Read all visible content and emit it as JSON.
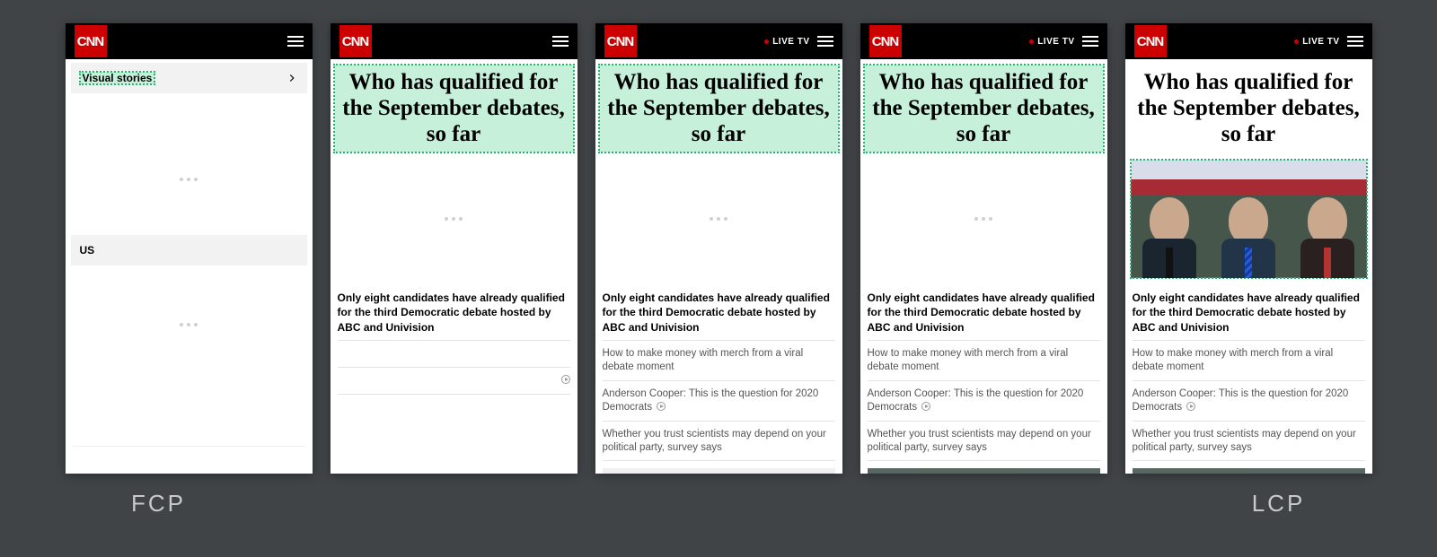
{
  "brand": "CNN",
  "live_tv": "LIVE TV",
  "sections": {
    "visual_stories": "Visual stories",
    "us": "US"
  },
  "headline": "Who has qualified for the September debates, so far",
  "summary": "Only eight candidates have already qualified for the third Democratic debate hosted by ABC and Univision",
  "links": {
    "l1": "How to make money with merch from a viral debate moment",
    "l2": "Anderson Cooper: This is the question for 2020 Democrats",
    "l3": "Whether you trust scientists may depend on your political party, survey says"
  },
  "labels": {
    "fcp": "FCP",
    "lcp": "LCP"
  }
}
